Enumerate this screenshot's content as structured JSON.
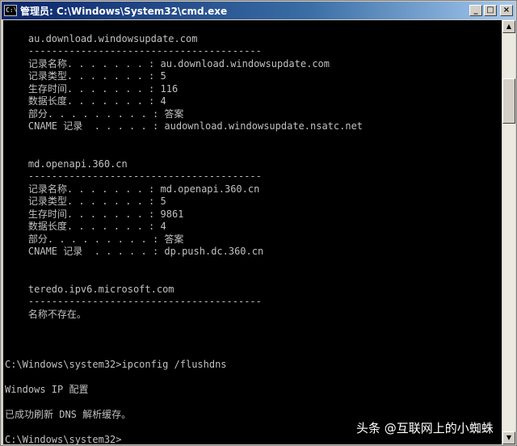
{
  "window": {
    "title": "管理员: C:\\Windows\\System32\\cmd.exe",
    "icon_name": "cmd-icon",
    "buttons": {
      "minimize": "_",
      "maximize": "□",
      "close": "×"
    }
  },
  "console": {
    "lines": [
      "",
      "    au.download.windowsupdate.com",
      "    ----------------------------------------",
      "    记录名称. . . . . . . : au.download.windowsupdate.com",
      "    记录类型. . . . . . . : 5",
      "    生存时间. . . . . . . : 116",
      "    数据长度. . . . . . . : 4",
      "    部分. . . . . . . . . : 答案",
      "    CNAME 记录  . . . . . : audownload.windowsupdate.nsatc.net",
      "",
      "",
      "    md.openapi.360.cn",
      "    ----------------------------------------",
      "    记录名称. . . . . . . : md.openapi.360.cn",
      "    记录类型. . . . . . . : 5",
      "    生存时间. . . . . . . : 9861",
      "    数据长度. . . . . . . : 4",
      "    部分. . . . . . . . . : 答案",
      "    CNAME 记录  . . . . . : dp.push.dc.360.cn",
      "",
      "",
      "    teredo.ipv6.microsoft.com",
      "    ----------------------------------------",
      "    名称不存在。",
      "",
      "",
      "",
      "C:\\Windows\\system32>ipconfig /flushdns",
      "",
      "Windows IP 配置",
      "",
      "已成功刷新 DNS 解析缓存。",
      "",
      "C:\\Windows\\system32>"
    ]
  },
  "scrollbar": {
    "up_icon": "scroll-up-arrow-icon",
    "down_icon": "scroll-down-arrow-icon",
    "up_glyph": "▲",
    "down_glyph": "▼"
  },
  "watermark": {
    "text": "头条 @互联网上的小蜘蛛"
  }
}
